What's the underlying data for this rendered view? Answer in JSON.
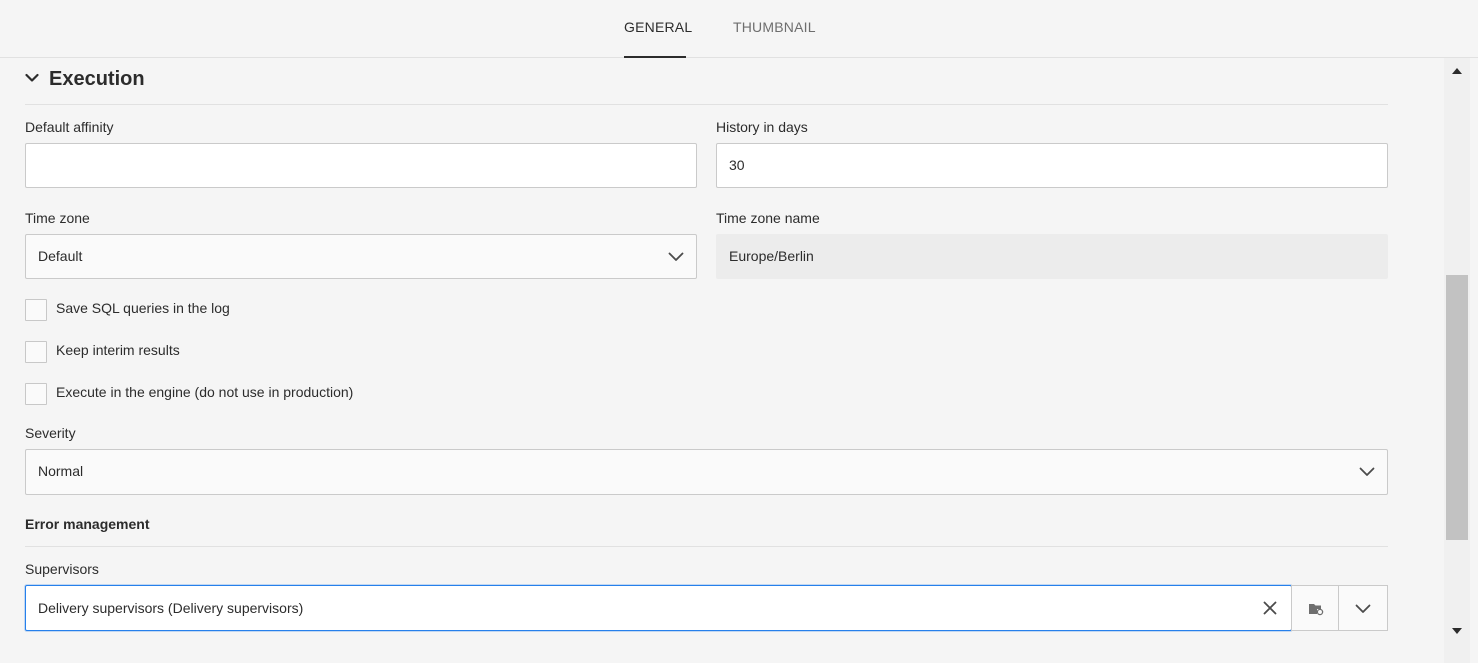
{
  "tabs": [
    {
      "label": "GENERAL",
      "active": true
    },
    {
      "label": "THUMBNAIL",
      "active": false
    }
  ],
  "section": {
    "title": "Execution",
    "icon": "chevron-down-icon"
  },
  "fields": {
    "default_affinity": {
      "label": "Default affinity",
      "value": ""
    },
    "history_days": {
      "label": "History in days",
      "value": "30"
    },
    "time_zone": {
      "label": "Time zone",
      "value": "Default"
    },
    "time_zone_name": {
      "label": "Time zone name",
      "value": "Europe/Berlin"
    },
    "severity": {
      "label": "Severity",
      "value": "Normal"
    }
  },
  "checkboxes": [
    {
      "label": "Save SQL queries in the log",
      "checked": false
    },
    {
      "label": "Keep interim results",
      "checked": false
    },
    {
      "label": "Execute in the engine (do not use in production)",
      "checked": false
    }
  ],
  "error_management": {
    "title": "Error management",
    "supervisors": {
      "label": "Supervisors",
      "value": "Delivery supervisors (Delivery supervisors)"
    }
  },
  "colors": {
    "accent": "#2680eb",
    "background": "#f5f5f5",
    "text": "#2c2c2c"
  }
}
